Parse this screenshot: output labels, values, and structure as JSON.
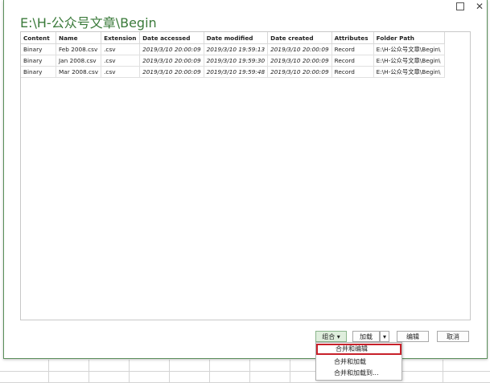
{
  "window": {
    "max_icon": "maximize-icon",
    "close_label": "✕",
    "path_title": "E:\\H-公众号文章\\Begin"
  },
  "table": {
    "headers": [
      "Content",
      "Name",
      "Extension",
      "Date accessed",
      "Date modified",
      "Date created",
      "Attributes",
      "Folder Path"
    ],
    "rows": [
      [
        "Binary",
        "Feb 2008.csv",
        ".csv",
        "2019/3/10 20:00:09",
        "2019/3/10 19:59:13",
        "2019/3/10 20:00:09",
        "Record",
        "E:\\H-公众号文章\\Begin\\"
      ],
      [
        "Binary",
        "Jan 2008.csv",
        ".csv",
        "2019/3/10 20:00:09",
        "2019/3/10 19:59:30",
        "2019/3/10 20:00:09",
        "Record",
        "E:\\H-公众号文章\\Begin\\"
      ],
      [
        "Binary",
        "Mar 2008.csv",
        ".csv",
        "2019/3/10 20:00:09",
        "2019/3/10 19:59:48",
        "2019/3/10 20:00:09",
        "Record",
        "E:\\H-公众号文章\\Begin\\"
      ]
    ]
  },
  "buttons": {
    "combine": "组合 ▾",
    "load": "加载",
    "load_arrow": "▾",
    "edit": "编辑",
    "cancel": "取消"
  },
  "menu": {
    "items": [
      "合并和编辑",
      "合并和加载",
      "合并和加载到..."
    ]
  },
  "colors": {
    "title_green": "#3a7a3a",
    "highlight_red": "#c8202a",
    "combine_bg": "#dfeedd"
  }
}
